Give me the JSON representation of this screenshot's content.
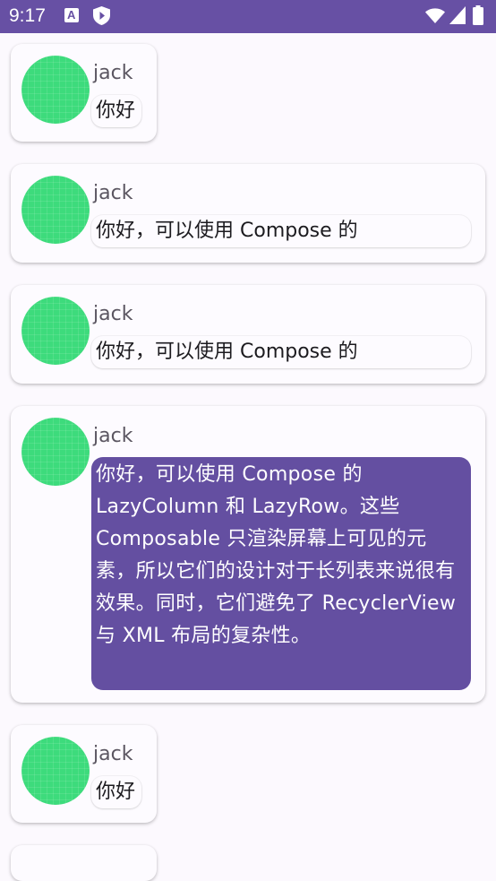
{
  "status_bar": {
    "time": "9:17",
    "icons": [
      "a-notification-icon",
      "shield-play-icon",
      "wifi-icon",
      "signal-icon",
      "battery-icon"
    ],
    "bg_color": "#6750a4"
  },
  "messages": [
    {
      "author": "jack",
      "body": "你好",
      "expanded": false
    },
    {
      "author": "jack",
      "body": "你好，可以使用 Compose 的",
      "expanded": false
    },
    {
      "author": "jack",
      "body": "你好，可以使用 Compose 的",
      "expanded": false
    },
    {
      "author": "jack",
      "body": "你好，可以使用 Compose 的 LazyColumn 和 LazyRow。这些 Composable 只渲染屏幕上可见的元素，所以它们的设计对于长列表来说很有效果。同时，它们避免了 RecyclerView 与 XML 布局的复杂性。",
      "expanded": true
    },
    {
      "author": "jack",
      "body": "你好",
      "expanded": false
    }
  ],
  "colors": {
    "accent": "#6750a4",
    "expanded_bubble": "#644fa1",
    "avatar": "#3ddb7c",
    "background": "#fcf9fe"
  }
}
